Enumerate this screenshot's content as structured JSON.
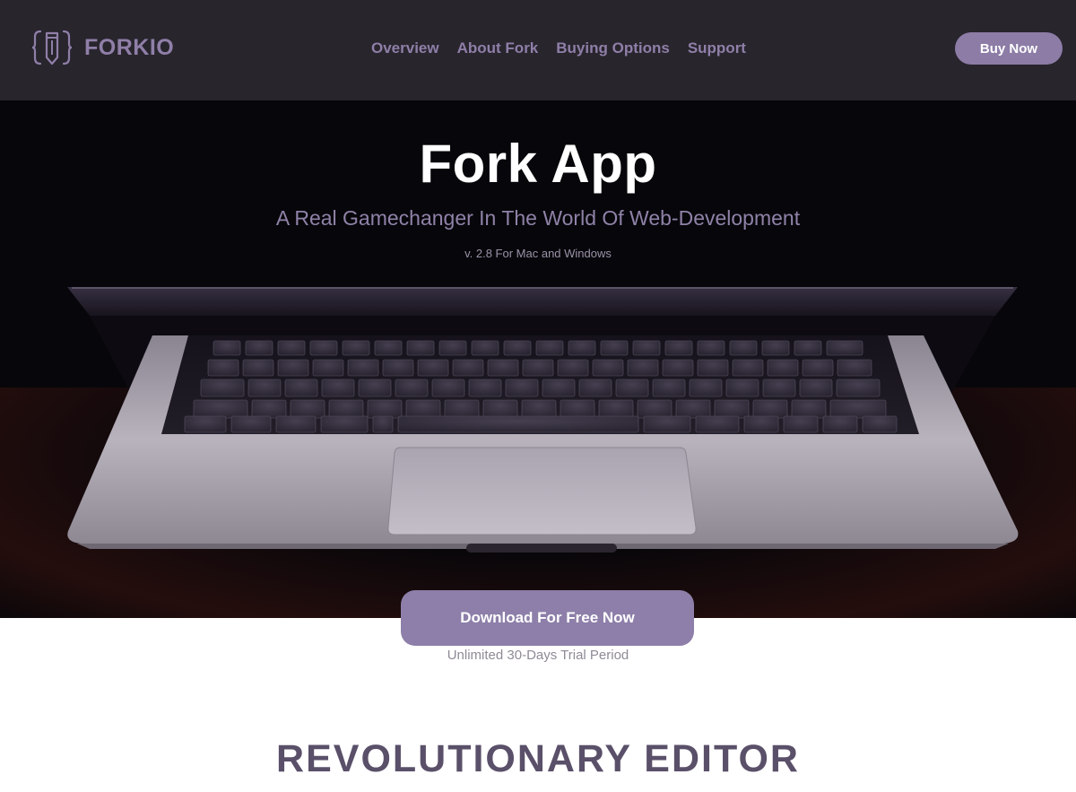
{
  "header": {
    "logo_text": "FORKIO",
    "nav": [
      {
        "label": "Overview"
      },
      {
        "label": "About Fork"
      },
      {
        "label": "Buying Options"
      },
      {
        "label": "Support"
      }
    ],
    "buy_label": "Buy Now"
  },
  "hero": {
    "title": "Fork App",
    "subtitle": "A Real Gamechanger In The World Of Web-Development",
    "version": "v. 2.8 For Mac and Windows"
  },
  "cta": {
    "download_label": "Download For Free Now",
    "trial_text": "Unlimited 30-Days Trial Period"
  },
  "section": {
    "title": "REVOLUTIONARY EDITOR"
  },
  "colors": {
    "header_bg": "#28252d",
    "accent": "#8d7fa9",
    "hero_bg": "#07060a",
    "section_title": "#5a5069"
  },
  "icons": {
    "logo": "pencil-brackets-icon"
  }
}
